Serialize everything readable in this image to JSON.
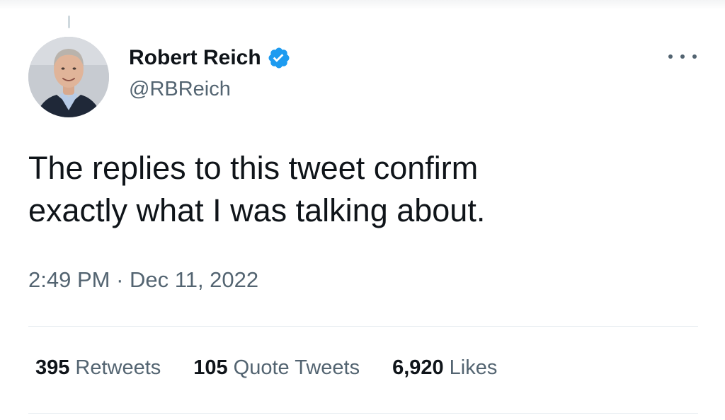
{
  "author": {
    "display_name": "Robert Reich",
    "handle": "@RBReich",
    "verified": true,
    "avatar_icon": "user-avatar-photo"
  },
  "tweet": {
    "text_lines": [
      "The replies to this tweet confirm",
      "exactly what I was talking about."
    ],
    "time": "2:49 PM",
    "separator": "·",
    "date": "Dec 11, 2022"
  },
  "stats": {
    "retweets": {
      "count": "395",
      "label": "Retweets"
    },
    "quotes": {
      "count": "105",
      "label": "Quote Tweets"
    },
    "likes": {
      "count": "6,920",
      "label": "Likes"
    }
  },
  "icons": {
    "verified": "verified-badge-icon",
    "more": "more-options-icon"
  },
  "colors": {
    "verified_blue": "#1d9bf0",
    "text_primary": "#0f1419",
    "text_secondary": "#536471",
    "divider": "#e6ecf0"
  }
}
